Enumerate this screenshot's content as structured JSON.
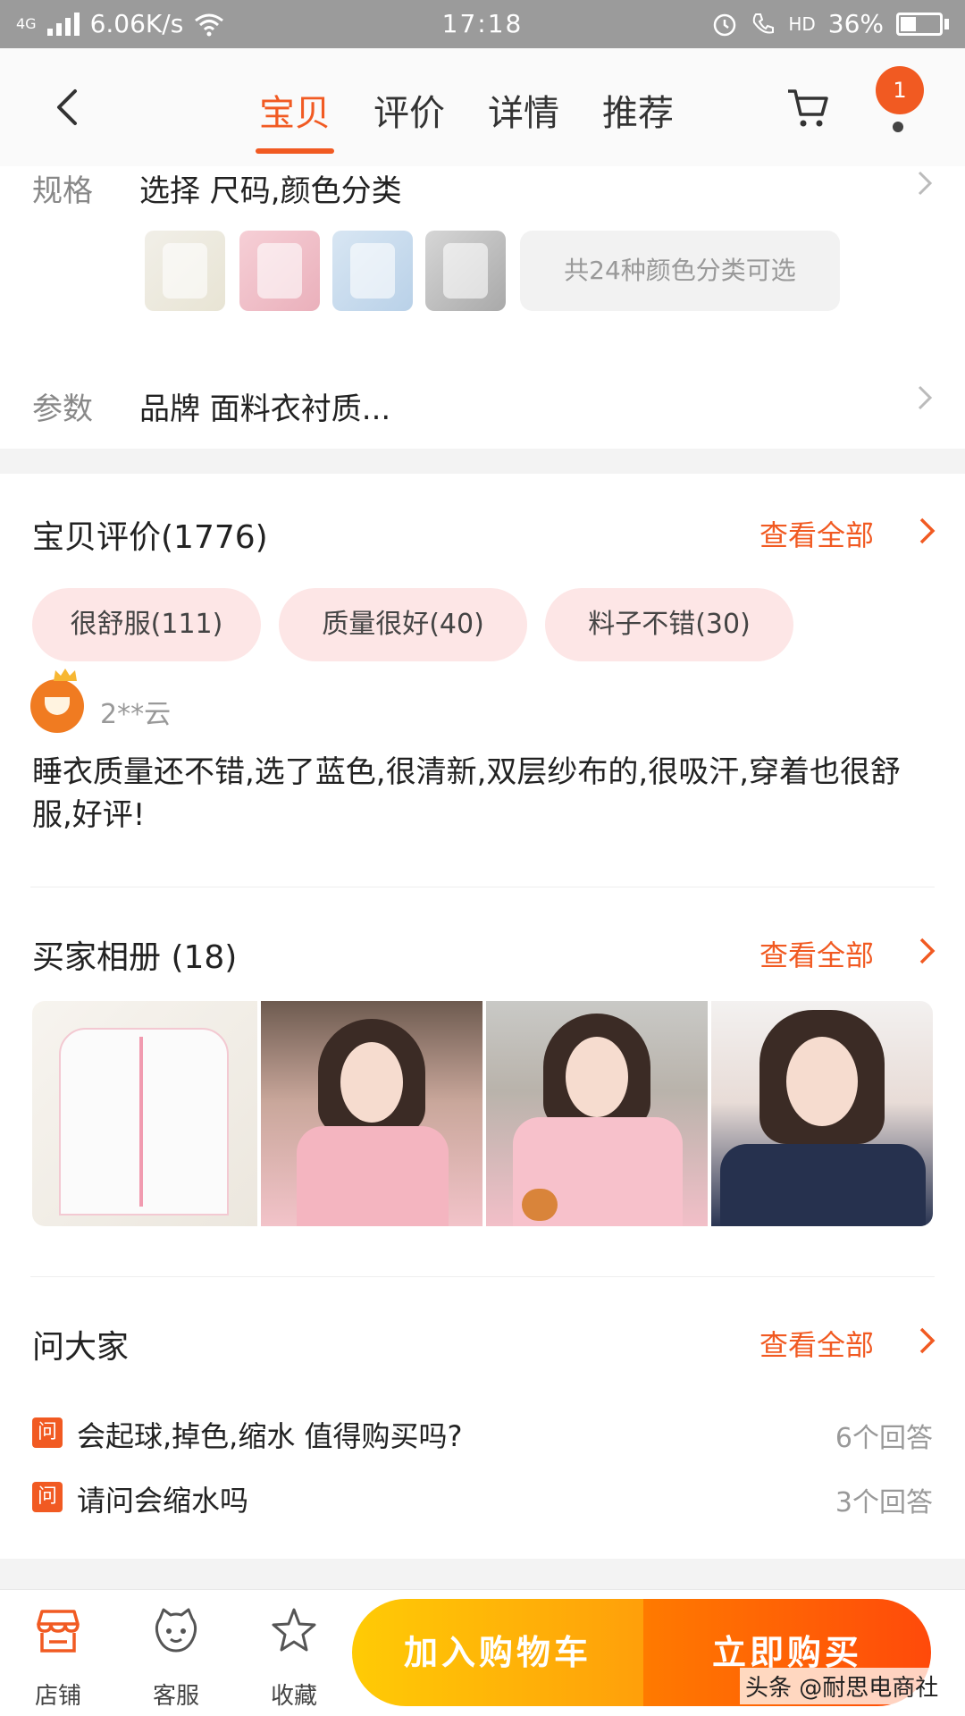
{
  "status_bar": {
    "network": "4G",
    "speed": "6.06K/s",
    "time": "17:18",
    "hd": "HD",
    "battery": "36%"
  },
  "nav": {
    "tabs": [
      {
        "label": "宝贝",
        "active": true
      },
      {
        "label": "评价",
        "active": false
      },
      {
        "label": "详情",
        "active": false
      },
      {
        "label": "推荐",
        "active": false
      }
    ],
    "badge": "1"
  },
  "spec": {
    "label": "规格",
    "text": "选择 尺码,颜色分类",
    "more_colors": "共24种颜色分类可选"
  },
  "params": {
    "label": "参数",
    "text": "品牌 面料衣衬质..."
  },
  "reviews": {
    "title": "宝贝评价(1776)",
    "see_all": "查看全部",
    "tags": [
      "很舒服(111)",
      "质量很好(40)",
      "料子不错(30)"
    ],
    "user": "2**云",
    "text": "睡衣质量还不错,选了蓝色,很清新,双层纱布的,很吸汗,穿着也很舒服,好评!"
  },
  "album": {
    "title": "买家相册 (18)",
    "see_all": "查看全部"
  },
  "qa": {
    "title": "问大家",
    "see_all": "查看全部",
    "icon": "问",
    "items": [
      {
        "q": "会起球,掉色,缩水 值得购买吗?",
        "count": "6个回答"
      },
      {
        "q": "请问会缩水吗",
        "count": "3个回答"
      }
    ]
  },
  "bottom": {
    "shop": "店铺",
    "service": "客服",
    "favorite": "收藏",
    "add_cart": "加入购物车",
    "buy_now": "立即购买"
  },
  "watermark": "头条 @耐思电商社",
  "colors": {
    "accent": "#f15a22",
    "tag_bg": "#fde6e6",
    "cart_btn": "#ffb300",
    "buy_btn": "#ff5a0a"
  }
}
